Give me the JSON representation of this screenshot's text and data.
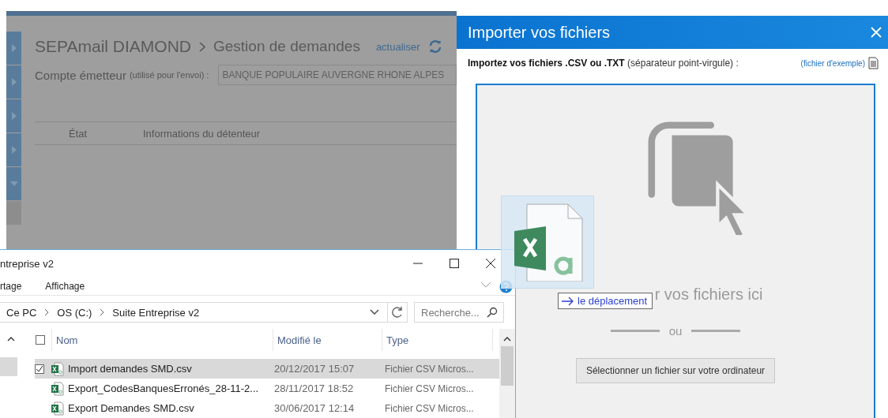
{
  "background_app": {
    "title": "SEPAmail DIAMOND",
    "breadcrumb": "Gestion de demandes",
    "refresh_link": "actualiser",
    "account_label": "Compte émetteur",
    "account_hint": "(utilisé pour l'envoi) :",
    "account_value": "BANQUE POPULAIRE AUVERGNE RHONE ALPES",
    "sidebar_items": [
      {
        "kind": "arrow"
      },
      {
        "kind": "arrow"
      },
      {
        "kind": "arrow"
      },
      {
        "kind": "arrow"
      },
      {
        "kind": "caret"
      },
      {
        "kind": "blank"
      }
    ],
    "columns": [
      "État",
      "Informations du détenteur"
    ]
  },
  "import_dialog": {
    "title": "Importer vos fichiers",
    "description": "**Importez vos fichiers .CSV ou .TXT** (séparateur point-virgule) :",
    "example_link": "(fichier d'exemple)",
    "drop_text": "r vos fichiers ici",
    "separator": "ou",
    "select_button": "Sélectionner un fichier sur votre ordinateur"
  },
  "drag_tooltip": {
    "label": "le déplacement"
  },
  "file_explorer": {
    "title": "ntreprise v2",
    "ribbon_tabs": [
      "rtage",
      "Affichage"
    ],
    "path": [
      "Ce PC",
      "OS (C:)",
      "Suite Entreprise v2"
    ],
    "search": {
      "placeholder": "Recherche..."
    },
    "select_all": {
      "checked": false
    },
    "columns": [
      "Nom",
      "Modifié le",
      "Type"
    ],
    "rows": [
      {
        "name": "Import demandes SMD.csv",
        "modified": "20/12/2017 15:07",
        "type": "Fichier CSV Micros...",
        "selected": true,
        "checked": true
      },
      {
        "name": "Export_CodesBanquesErronés_28-11-2...",
        "modified": "28/11/2017 18:52",
        "type": "Fichier CSV Micros...",
        "selected": false,
        "checked": false
      },
      {
        "name": "Export Demandes SMD.csv",
        "modified": "30/06/2017 12:14",
        "type": "Fichier CSV Micros...",
        "selected": false,
        "checked": false
      }
    ]
  }
}
